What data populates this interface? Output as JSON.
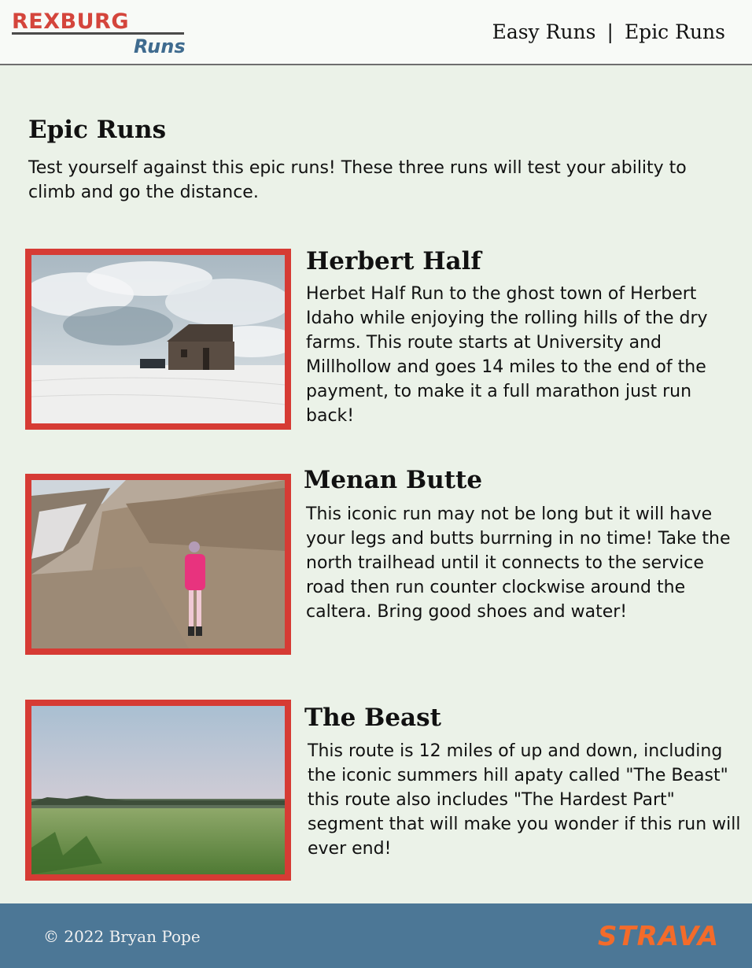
{
  "header": {
    "logo_top": "REXBURG",
    "logo_bottom": "Runs",
    "nav": [
      {
        "label": "Easy Runs"
      },
      {
        "label": "Epic Runs"
      }
    ],
    "separator": "|"
  },
  "main": {
    "title": "Epic Runs",
    "intro": "Test yourself against this epic runs! These three runs will test your ability to climb and go the distance."
  },
  "runs": [
    {
      "title": "Herbert Half",
      "description": "Herbet Half Run to the ghost town of Herbert Idaho while enjoying the rolling hills of the dry farms. This route starts at University and Millhollow and goes 14 miles to the end of the payment, to make it a full marathon just run back!"
    },
    {
      "title": "Menan Butte",
      "description": "This iconic run may not be long but it will have your legs and butts burrning in no time! Take the north trailhead until it connects to the service road then run counter clockwise around the caltera. Bring good shoes and water!"
    },
    {
      "title": "The Beast",
      "description": "This route is 12 miles of up and down, including the iconic summers hill apaty called \"The Beast\" this route also includes \"The Hardest Part\" segment that will make you wonder if this run will ever end!"
    }
  ],
  "footer": {
    "copyright": "© 2022 Bryan Pope",
    "brand": "STRAVA"
  },
  "colors": {
    "background": "#ebf2e8",
    "accent_red": "#d63b34",
    "footer_blue": "#4c7796",
    "strava_orange": "#f36b2a",
    "logo_blue": "#3f6b8f"
  }
}
